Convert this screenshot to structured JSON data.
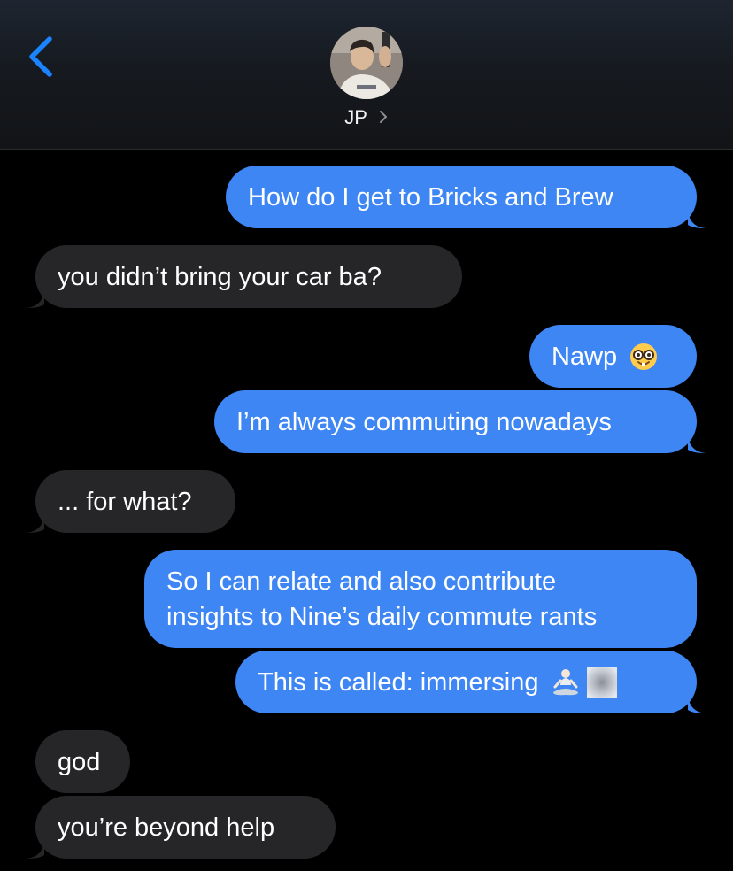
{
  "header": {
    "contact_name": "JP",
    "contact_chevron": "›"
  },
  "icons": {
    "back": "chevron-left-icon",
    "avatar": "contact-avatar",
    "nerd_emoji": "nerd-face-emoji",
    "meditation_emoji": "person-in-lotus-position-emoji",
    "blurred_emoji": "blurred-emoji"
  },
  "messages": [
    {
      "direction": "outgoing",
      "text": "How do I get to Bricks and Brew"
    },
    {
      "direction": "incoming",
      "text": "you didn’t bring your car ba?"
    },
    {
      "direction": "outgoing",
      "text": "Nawp"
    },
    {
      "direction": "outgoing",
      "text": "I’m always commuting nowadays"
    },
    {
      "direction": "incoming",
      "text": "... for what?"
    },
    {
      "direction": "outgoing",
      "lines": [
        "So I can relate and also contribute",
        "insights to Nine’s daily commute rants"
      ]
    },
    {
      "direction": "outgoing",
      "text": "This is called: immersing"
    },
    {
      "direction": "incoming",
      "text": "god"
    },
    {
      "direction": "incoming",
      "text": "you’re beyond help"
    }
  ],
  "colors": {
    "outgoing_bubble": "#3e86f4",
    "incoming_bubble": "#262629",
    "accent": "#1a84ff",
    "background": "#000000"
  }
}
